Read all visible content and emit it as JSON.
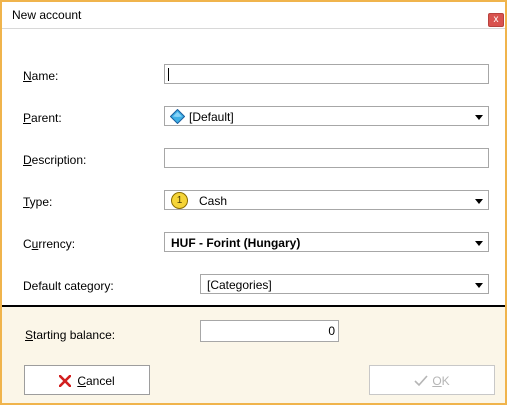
{
  "window": {
    "title": "New account",
    "close_glyph": "x"
  },
  "form": {
    "name": {
      "label_key": "N",
      "label_rest": "ame:",
      "value": ""
    },
    "parent": {
      "label_key": "P",
      "label_rest": "arent:",
      "value": "[Default]",
      "icon": "blue-diamond-icon"
    },
    "description": {
      "label_key": "D",
      "label_rest": "escription:",
      "value": ""
    },
    "type": {
      "label_key": "T",
      "label_rest": "ype:",
      "value": "Cash",
      "icon_text": "1"
    },
    "currency": {
      "label_pre": "C",
      "label_key": "u",
      "label_rest": "rrency:",
      "value": "HUF - Forint (Hungary)"
    },
    "default_category": {
      "label": "Default category:",
      "value": "[Categories]"
    },
    "starting_balance": {
      "label_key": "S",
      "label_rest": "tarting balance:",
      "value": "0"
    }
  },
  "buttons": {
    "cancel": {
      "label_key": "C",
      "label_rest": "ancel",
      "icon": "red-x-icon"
    },
    "ok": {
      "label_key": "O",
      "label_rest": "K",
      "icon": "checkmark-icon",
      "disabled": true
    }
  },
  "colors": {
    "window_border": "#f0b44c",
    "footer_bg": "#fbf6e8",
    "cancel_icon": "#d21f1f"
  }
}
